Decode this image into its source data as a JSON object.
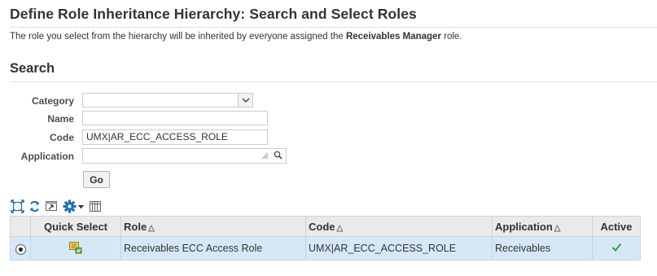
{
  "page": {
    "title": "Define Role Inheritance Hierarchy: Search and Select Roles",
    "instruction_prefix": "The role you select from the hierarchy will be inherited by everyone assigned the ",
    "instruction_role": "Receivables Manager",
    "instruction_suffix": " role."
  },
  "search": {
    "title": "Search",
    "category_label": "Category",
    "category_value": "",
    "name_label": "Name",
    "name_value": "",
    "code_label": "Code",
    "code_value": "UMX|AR_ECC_ACCESS_ROLE",
    "application_label": "Application",
    "application_value": "",
    "go_label": "Go"
  },
  "toolbar": {
    "icons": [
      "detach-icon",
      "refresh-icon",
      "export-icon",
      "settings-icon",
      "columns-icon"
    ]
  },
  "table": {
    "columns": [
      "",
      "Quick Select",
      "Role",
      "Code",
      "Application",
      "Active"
    ],
    "rows": [
      {
        "selected": true,
        "role": "Receivables ECC Access Role",
        "code": "UMX|AR_ECC_ACCESS_ROLE",
        "application": "Receivables",
        "active": true
      }
    ]
  },
  "colors": {
    "row_selected": "#d6e8f7",
    "header_bg": "#eaeaea",
    "check_green": "#3f9b2c",
    "icon_blue": "#1d6fb8"
  }
}
